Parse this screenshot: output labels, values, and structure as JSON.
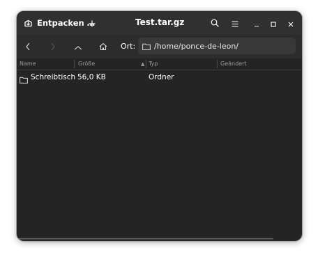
{
  "window": {
    "title": "Test.tar.gz"
  },
  "header": {
    "extract_label": "Entpacken …",
    "extract_icon": "package-extract-icon",
    "new_icon": "plus-icon",
    "search_icon": "search-icon",
    "menu_icon": "hamburger-menu-icon",
    "minimize_icon": "minimize-icon",
    "maximize_icon": "maximize-icon",
    "close_icon": "close-icon"
  },
  "toolbar": {
    "location_label": "Ort:",
    "location_path": "/home/ponce-de-leon/",
    "back_icon": "chevron-left-icon",
    "forward_icon": "chevron-right-icon",
    "up_icon": "chevron-up-icon",
    "home_icon": "home-icon"
  },
  "file_list": {
    "columns": [
      "Name",
      "Größe",
      "Typ",
      "Geändert"
    ],
    "rows": [
      {
        "name": "Schreibtisch",
        "size": "56,0 KB",
        "type": "Ordner",
        "modified": ""
      }
    ]
  },
  "colors": {
    "window_bg": "#242424",
    "header_bg": "#303030",
    "toolbar_bg": "#2c2c2c",
    "field_bg": "#383838",
    "text": "#ffffff",
    "muted_text": "#9a9a9a"
  }
}
